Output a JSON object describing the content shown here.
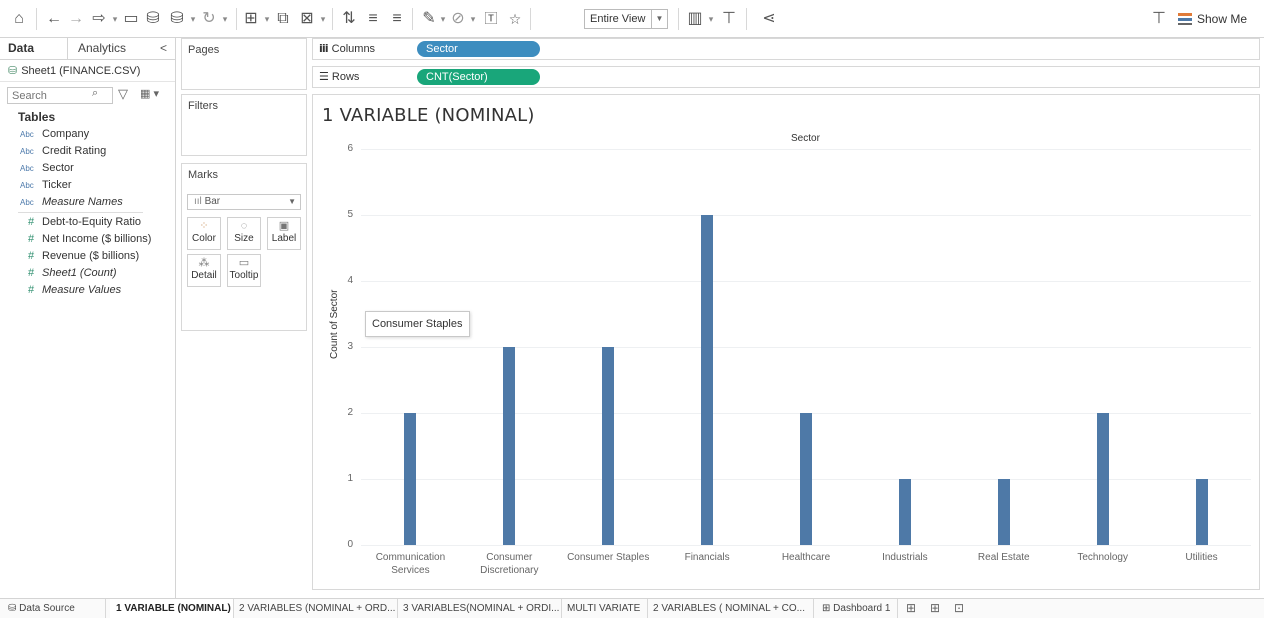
{
  "toolbar": {
    "view_select": "Entire View",
    "show_me": "Show Me",
    "icons": [
      "home-icon",
      "back-icon",
      "forward-icon",
      "redo-icon",
      "save-icon",
      "new-datasource-icon",
      "pause-icon",
      "refresh-icon",
      "new-worksheet-icon",
      "duplicate-icon",
      "clear-icon",
      "swap-icon",
      "sort-ascending-icon",
      "sort-descending-icon",
      "highlight-icon",
      "group-icon",
      "label-icon",
      "pin-icon",
      "show-cards-icon",
      "presentation-icon",
      "share-icon",
      "pin-right-icon"
    ]
  },
  "data_pane": {
    "tab_data": "Data",
    "tab_analytics": "Analytics",
    "collapse": "<",
    "source": "Sheet1 (FINANCE.CSV)",
    "search_placeholder": "Search",
    "tables_heading": "Tables",
    "dimensions": [
      {
        "type": "Abc",
        "name": "Company",
        "italic": false
      },
      {
        "type": "Abc",
        "name": "Credit Rating",
        "italic": false
      },
      {
        "type": "Abc",
        "name": "Sector",
        "italic": false
      },
      {
        "type": "Abc",
        "name": "Ticker",
        "italic": false
      },
      {
        "type": "Abc",
        "name": "Measure Names",
        "italic": true
      }
    ],
    "measures": [
      {
        "type": "#",
        "name": "Debt-to-Equity Ratio",
        "italic": false
      },
      {
        "type": "#",
        "name": "Net Income ($ billions)",
        "italic": false
      },
      {
        "type": "#",
        "name": "Revenue ($ billions)",
        "italic": false
      },
      {
        "type": "#",
        "name": "Sheet1 (Count)",
        "italic": true
      },
      {
        "type": "#",
        "name": "Measure Values",
        "italic": true
      }
    ]
  },
  "cards": {
    "pages": "Pages",
    "filters": "Filters",
    "marks": "Marks",
    "mark_type": "Bar",
    "mark_buttons": [
      {
        "label": "Color",
        "icon": "color-icon"
      },
      {
        "label": "Size",
        "icon": "size-icon"
      },
      {
        "label": "Label",
        "icon": "label-icon"
      },
      {
        "label": "Detail",
        "icon": "detail-icon"
      },
      {
        "label": "Tooltip",
        "icon": "tooltip-icon"
      }
    ]
  },
  "shelves": {
    "columns_label": "Columns",
    "columns_pill": "Sector",
    "rows_label": "Rows",
    "rows_pill": "CNT(Sector)"
  },
  "viz": {
    "title": "1 VARIABLE (NOMINAL)",
    "tooltip": "Consumer Staples"
  },
  "chart_data": {
    "type": "bar",
    "title": "1 VARIABLE (NOMINAL)",
    "column_header": "Sector",
    "xlabel": "",
    "ylabel": "Count of Sector",
    "ylim": [
      0,
      6
    ],
    "yticks": [
      0,
      1,
      2,
      3,
      4,
      5,
      6
    ],
    "categories": [
      "Communication Services",
      "Consumer Discretionary",
      "Consumer Staples",
      "Financials",
      "Healthcare",
      "Industrials",
      "Real Estate",
      "Technology",
      "Utilities"
    ],
    "category_lines": [
      [
        "Communication",
        "Services"
      ],
      [
        "Consumer",
        "Discretionary"
      ],
      [
        "Consumer Staples"
      ],
      [
        "Financials"
      ],
      [
        "Healthcare"
      ],
      [
        "Industrials"
      ],
      [
        "Real Estate"
      ],
      [
        "Technology"
      ],
      [
        "Utilities"
      ]
    ],
    "values": [
      2,
      3,
      3,
      5,
      2,
      1,
      1,
      2,
      1
    ],
    "bar_color": "#4e79a7",
    "grid": true
  },
  "sheet_tabs": {
    "data_source": "Data Source",
    "tabs": [
      "1 VARIABLE (NOMINAL)",
      "2 VARIABLES (NOMINAL + ORD...",
      "3 VARIABLES(NOMINAL + ORDI...",
      "MULTI VARIATE",
      "2 VARIABLES ( NOMINAL + CO...",
      "Dashboard 1"
    ],
    "active": "1 VARIABLE (NOMINAL)"
  }
}
